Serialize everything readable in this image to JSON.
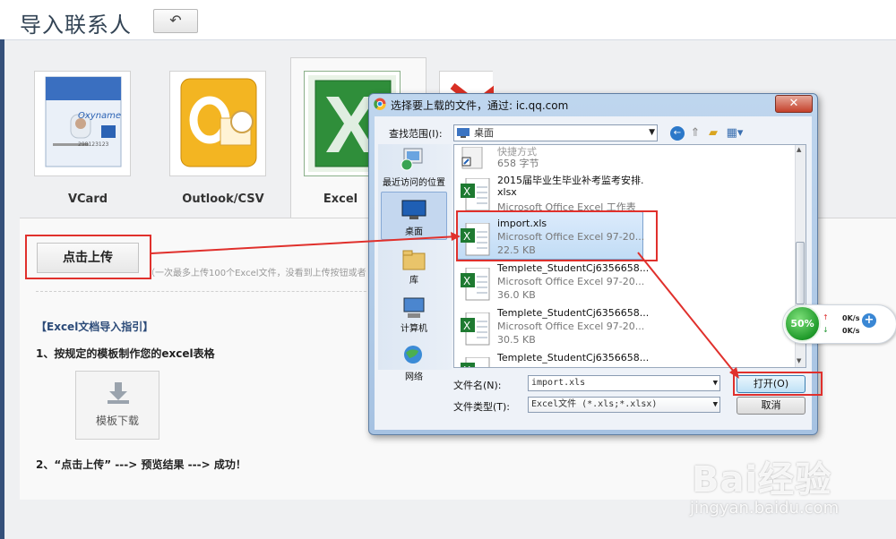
{
  "page": {
    "title": "导入联系人",
    "back_icon": "↶"
  },
  "sources": [
    {
      "id": "vcard",
      "label": "VCard",
      "card_text": "Oxyname",
      "card_num": "298123123"
    },
    {
      "id": "outlook",
      "label": "Outlook/CSV"
    },
    {
      "id": "excel",
      "label": "Excel"
    },
    {
      "id": "gmail",
      "label": ""
    }
  ],
  "upload": {
    "button_label": "点击上传",
    "hint": "（一次最多上传100个Excel文件，没看到上传按钮或者"
  },
  "guide": {
    "heading": "【Excel文档导入指引】",
    "step1": "1、按规定的模板制作您的excel表格",
    "template_button": "模板下载",
    "step2": "2、“点击上传” ---> 预览结果 ---> 成功！"
  },
  "dialog": {
    "title": "选择要上载的文件，通过: ic.qq.com",
    "close_icon": "✕",
    "look_in_label": "查找范围(I):",
    "look_in_value": "桌面",
    "places": [
      {
        "label": "最近访问的位置"
      },
      {
        "label": "桌面"
      },
      {
        "label": "库"
      },
      {
        "label": "计算机"
      },
      {
        "label": "网络"
      }
    ],
    "files": [
      {
        "name": "快捷方式",
        "type": "",
        "size": "658 字节"
      },
      {
        "name": "2015届毕业生毕业补考监考安排.",
        "name2": "xlsx",
        "type": "Microsoft Office Excel 工作表",
        "size": ""
      },
      {
        "name": "import.xls",
        "type": "Microsoft Office Excel 97-20...",
        "size": "22.5 KB"
      },
      {
        "name": "Templete_StudentCj6356658...",
        "type": "Microsoft Office Excel 97-20...",
        "size": "36.0 KB"
      },
      {
        "name": "Templete_StudentCj6356658...",
        "type": "Microsoft Office Excel 97-20...",
        "size": "30.5 KB"
      },
      {
        "name": "Templete_StudentCj6356658...",
        "type": "",
        "size": ""
      }
    ],
    "filename_label": "文件名(N):",
    "filename_value": "import.xls",
    "filetype_label": "文件类型(T):",
    "filetype_value": "Excel文件 (*.xls;*.xlsx)",
    "open_button": "打开(O)",
    "cancel_button": "取消"
  },
  "speed_widget": {
    "percent": "50%",
    "up": "0K/s",
    "down": "0K/s",
    "plus": "+"
  },
  "watermark": {
    "brand": "Bai经验",
    "url": "jingyan.baidu.com"
  },
  "colors": {
    "highlight_red": "#e0302c",
    "title_blue": "#345",
    "selection_blue": "#c1dcf5",
    "excel_green": "#1e7a31"
  }
}
